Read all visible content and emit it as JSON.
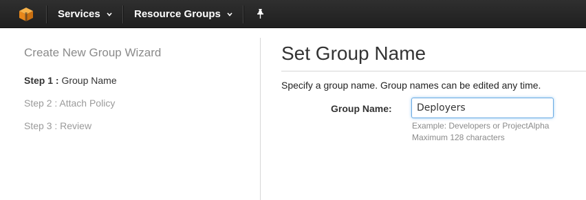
{
  "topbar": {
    "logo_icon": "aws-cube-icon",
    "services_label": "Services",
    "resource_groups_label": "Resource Groups",
    "pin_icon": "pin-icon",
    "colors": {
      "bar": "#232323",
      "logo": "#f7981d"
    }
  },
  "wizard": {
    "title": "Create New Group Wizard",
    "steps": [
      {
        "num": "Step 1 :",
        "label": "Group Name",
        "active": true
      },
      {
        "num": "Step 2 :",
        "label": "Attach Policy",
        "active": false
      },
      {
        "num": "Step 3 :",
        "label": "Review",
        "active": false
      }
    ]
  },
  "main": {
    "title": "Set Group Name",
    "description": "Specify a group name. Group names can be edited any time.",
    "group_name": {
      "label": "Group Name:",
      "value": "Deployers",
      "hint_example": "Example: Developers or ProjectAlpha",
      "hint_max": "Maximum 128 characters"
    }
  }
}
